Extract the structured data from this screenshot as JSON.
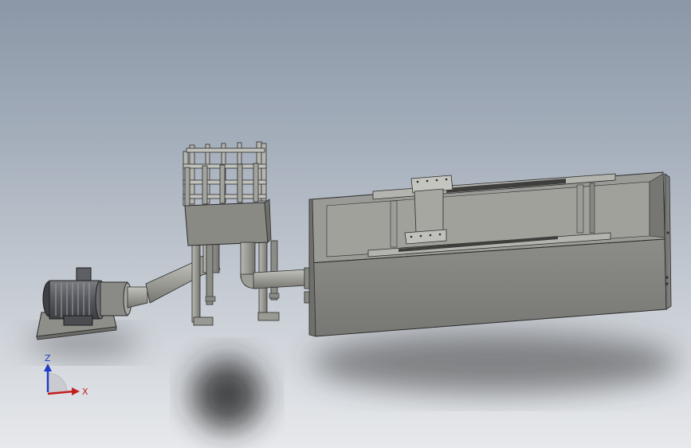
{
  "viewport": {
    "axes": {
      "z_label": "Z",
      "x_label": "X"
    },
    "colors": {
      "background_top": "#8b97a7",
      "background_bottom": "#e7e9ec",
      "model_light": "#a8a8a3",
      "model_mid": "#8d8d88",
      "model_dark": "#6f6f6b",
      "edge": "#2b2b2b",
      "z_axis": "#1f3cc4",
      "x_axis": "#c41f1f"
    },
    "components": [
      "motor-icon",
      "motor-base-plate-icon",
      "suction-pipe-icon",
      "tower-frame-icon",
      "discharge-pipe-icon",
      "tank-icon",
      "tank-crossbeam-icon"
    ]
  }
}
